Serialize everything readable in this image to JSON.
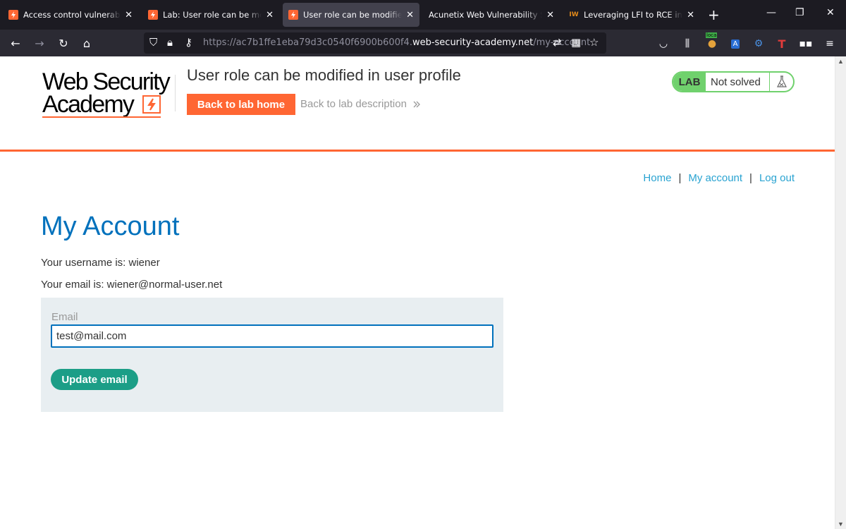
{
  "browser": {
    "tabs": [
      {
        "title": "Access control vulnerabilities"
      },
      {
        "title": "Lab: User role can be modified in user profile"
      },
      {
        "title": "User role can be modified in user profile"
      },
      {
        "title": "Acunetix Web Vulnerability Scanner"
      },
      {
        "title": "Leveraging LFI to RCE in a website"
      }
    ],
    "iw_favicon": "IW",
    "new_tab_label": "+",
    "url_prefix": "https://ac7b1ffe1eba79d3c0540f6900b600f4.",
    "url_host": "web-security-academy.net",
    "url_path": "/my-account",
    "extension_badge": "loca",
    "icons": {
      "back": "back-arrow-icon",
      "forward": "forward-arrow-icon",
      "reload": "reload-icon",
      "home": "home-icon",
      "shield": "shield-icon",
      "lock": "lock-icon",
      "key": "key-icon",
      "translate": "translate-icon",
      "grid": "qr-grid-icon",
      "star": "bookmark-star-icon",
      "pocket": "pocket-icon",
      "library": "library-icon",
      "menu": "hamburger-menu-icon"
    }
  },
  "header": {
    "logo_line1": "Web Security",
    "logo_line2": "Academy",
    "lab_title": "User role can be modified in user profile",
    "back_home": "Back to lab home",
    "back_description": "Back to lab description",
    "lab_tag": "LAB",
    "lab_state": "Not solved"
  },
  "nav": {
    "home": "Home",
    "my_account": "My account",
    "logout": "Log out",
    "separator": "|"
  },
  "main": {
    "heading": "My Account",
    "username_line": "Your username is: wiener",
    "email_line": "Your email is: wiener@normal-user.net",
    "email_label": "Email",
    "email_value": "test@mail.com",
    "update_button": "Update email"
  },
  "colors": {
    "brand_orange": "#ff6633",
    "link_blue": "#29a3d1",
    "heading_blue": "#0071bc",
    "lab_green": "#70d16d",
    "button_teal": "#1c9e87"
  }
}
